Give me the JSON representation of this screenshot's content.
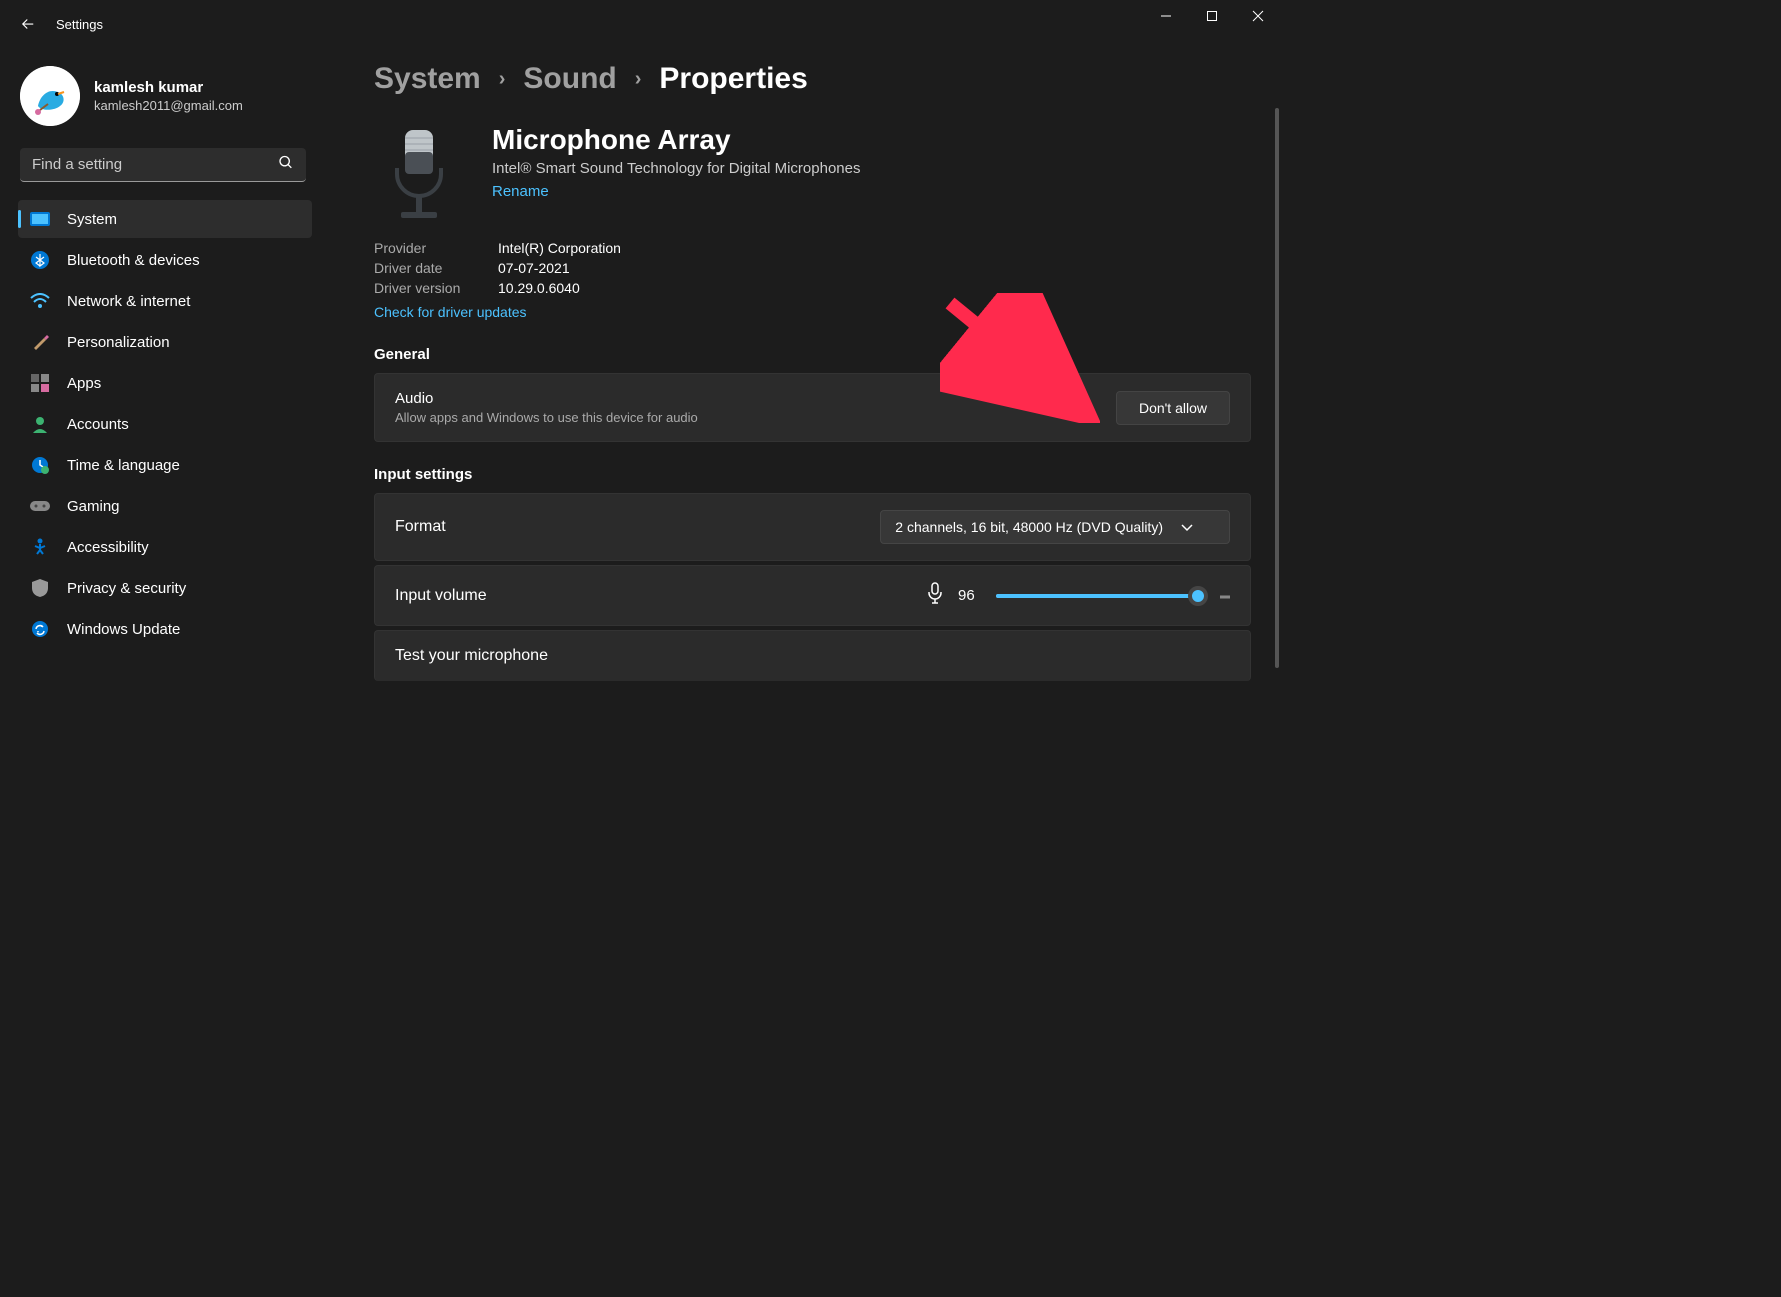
{
  "app": {
    "title": "Settings"
  },
  "profile": {
    "name": "kamlesh kumar",
    "email": "kamlesh2011@gmail.com"
  },
  "search": {
    "placeholder": "Find a setting"
  },
  "nav": [
    {
      "label": "System",
      "icon": "system"
    },
    {
      "label": "Bluetooth & devices",
      "icon": "bluetooth"
    },
    {
      "label": "Network & internet",
      "icon": "wifi"
    },
    {
      "label": "Personalization",
      "icon": "brush"
    },
    {
      "label": "Apps",
      "icon": "apps"
    },
    {
      "label": "Accounts",
      "icon": "account"
    },
    {
      "label": "Time & language",
      "icon": "clock"
    },
    {
      "label": "Gaming",
      "icon": "gaming"
    },
    {
      "label": "Accessibility",
      "icon": "accessibility"
    },
    {
      "label": "Privacy & security",
      "icon": "shield"
    },
    {
      "label": "Windows Update",
      "icon": "update"
    }
  ],
  "breadcrumb": {
    "a": "System",
    "b": "Sound",
    "c": "Properties"
  },
  "device": {
    "name": "Microphone Array",
    "sub": "Intel® Smart Sound Technology for Digital Microphones",
    "rename": "Rename",
    "provider_k": "Provider",
    "provider_v": "Intel(R) Corporation",
    "date_k": "Driver date",
    "date_v": "07-07-2021",
    "ver_k": "Driver version",
    "ver_v": "10.29.0.6040",
    "check": "Check for driver updates"
  },
  "general": {
    "heading": "General",
    "audio_title": "Audio",
    "audio_desc": "Allow apps and Windows to use this device for audio",
    "btn": "Don't allow"
  },
  "input": {
    "heading": "Input settings",
    "format_label": "Format",
    "format_value": "2 channels, 16 bit, 48000 Hz (DVD Quality)",
    "volume_label": "Input volume",
    "volume_value": "96",
    "test_label": "Test your microphone"
  }
}
